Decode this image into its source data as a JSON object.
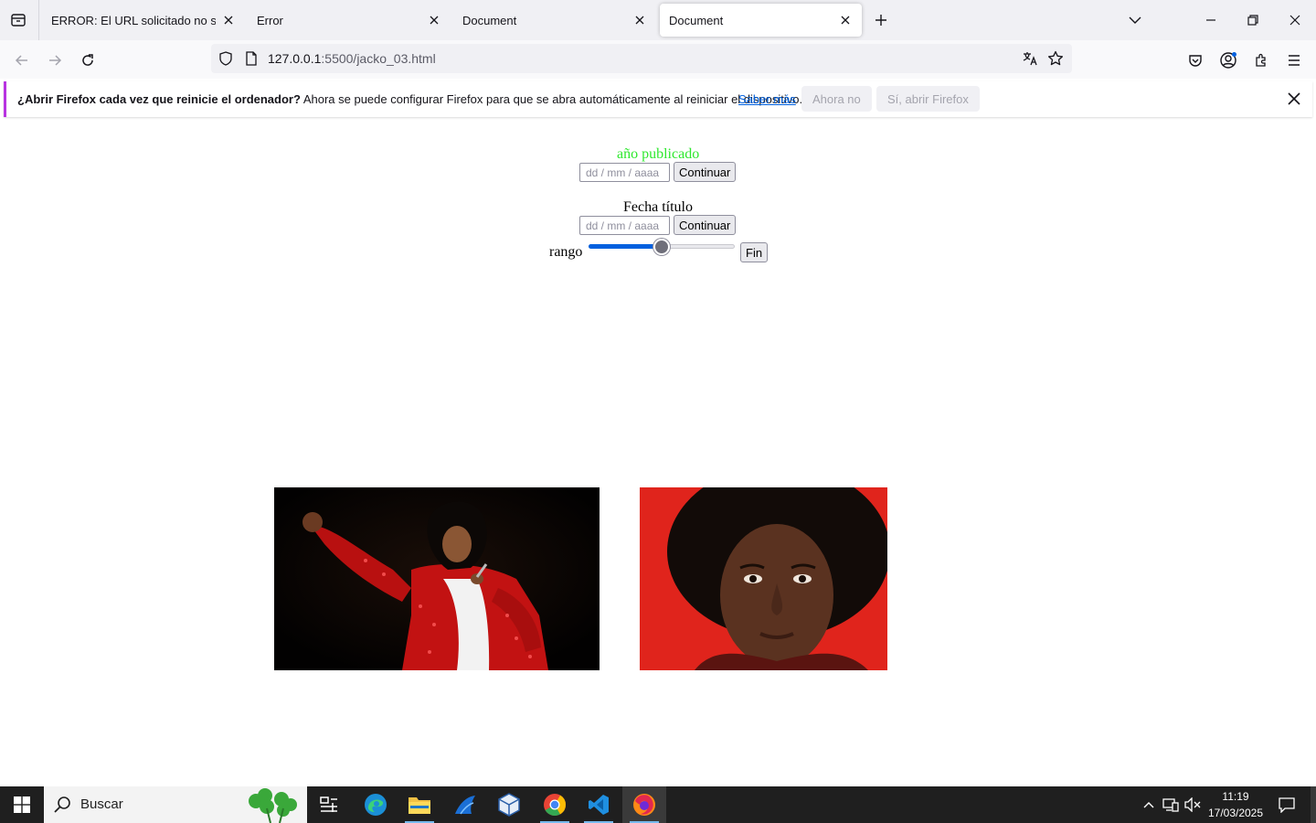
{
  "browser": {
    "tabs": [
      {
        "title": "ERROR: El URL solicitado no se ha podido conseguir",
        "active": false
      },
      {
        "title": "Error",
        "active": false
      },
      {
        "title": "Document",
        "active": false
      },
      {
        "title": "Document",
        "active": true
      }
    ],
    "url_host": "127.0.0.1",
    "url_rest": ":5500/jacko_03.html"
  },
  "notification": {
    "bold_text": "¿Abrir Firefox cada vez que reinicie el ordenador?",
    "text": " Ahora se puede configurar Firefox para que se abra automáticamente al reiniciar el dispositivo.",
    "learn_more": "Saber más",
    "not_now": "Ahora no",
    "open_firefox": "Sí, abrir Firefox"
  },
  "page": {
    "published_label": "año publicado",
    "published_color": "#2ee82e",
    "date_placeholder": "dd / mm / aaaa",
    "continue_label": "Continuar",
    "title_date_label": "Fecha título",
    "range_label": "rango",
    "range_value_fraction": 0.5,
    "fin_label": "Fin",
    "images": [
      {
        "subject": "Michael Jackson performing in red sequined jacket"
      },
      {
        "subject": "Young Michael Jackson portrait on red background"
      }
    ]
  },
  "taskbar": {
    "search_placeholder": "Buscar",
    "time": "11:19",
    "date": "17/03/2025",
    "apps": [
      "task-view-icon",
      "edge-icon",
      "file-explorer-icon",
      "sharp-icon",
      "virtualbox-icon",
      "chrome-icon",
      "vscode-icon",
      "firefox-icon"
    ]
  },
  "colors": {
    "accent_blue": "#0060df",
    "notification_accent": "#b833e1",
    "link": "#0061e0"
  }
}
